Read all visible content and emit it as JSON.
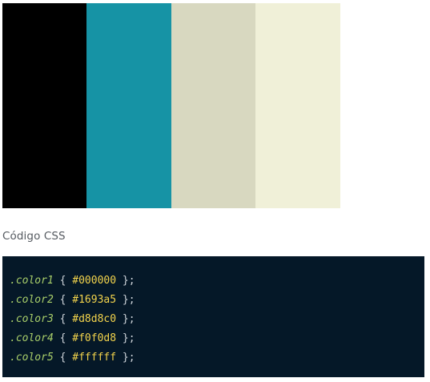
{
  "palette": {
    "swatches": [
      {
        "color": "#000000"
      },
      {
        "color": "#1693a5"
      },
      {
        "color": "#d8d8c0"
      },
      {
        "color": "#f0f0d8"
      }
    ]
  },
  "css_section": {
    "heading": "Código CSS",
    "lines": [
      {
        "selector": ".color1",
        "open": "{",
        "value": "#000000",
        "close": "};"
      },
      {
        "selector": ".color2",
        "open": "{",
        "value": "#1693a5",
        "close": "};"
      },
      {
        "selector": ".color3",
        "open": "{",
        "value": "#d8d8c0",
        "close": "};"
      },
      {
        "selector": ".color4",
        "open": "{",
        "value": "#f0f0d8",
        "close": "};"
      },
      {
        "selector": ".color5",
        "open": "{",
        "value": "#ffffff",
        "close": "};"
      }
    ]
  },
  "theme": {
    "code_background": "#051828",
    "selector_color": "#a9cf6a",
    "value_color": "#f2d34c"
  }
}
